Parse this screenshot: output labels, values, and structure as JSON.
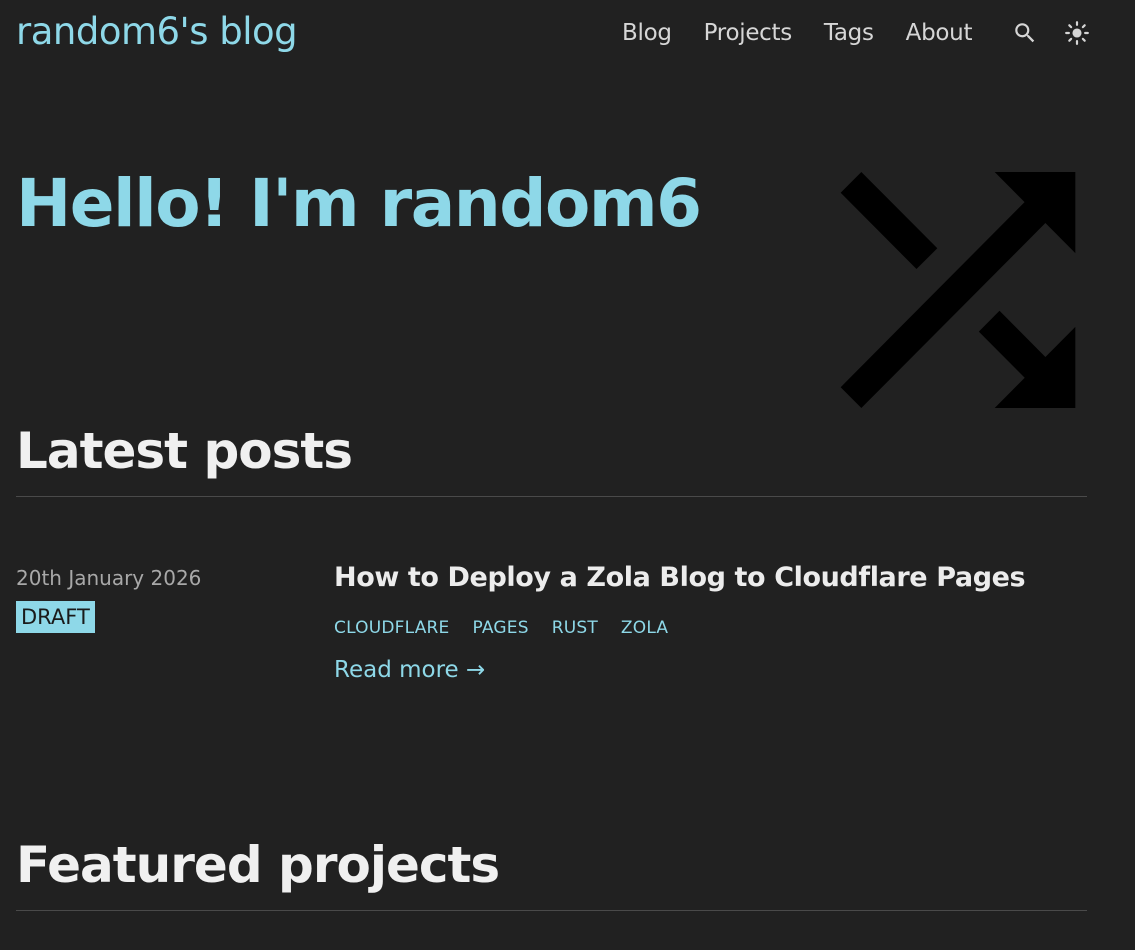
{
  "header": {
    "site_title": "random6's blog",
    "nav": [
      {
        "label": "Blog"
      },
      {
        "label": "Projects"
      },
      {
        "label": "Tags"
      },
      {
        "label": "About"
      }
    ],
    "icons": [
      "search-icon",
      "theme-toggle-sun-icon"
    ]
  },
  "hero": {
    "title": "Hello! I'm random6",
    "logo_icon": "shuffle-icon"
  },
  "latest_posts": {
    "heading": "Latest posts",
    "posts": [
      {
        "date": "20th January 2026",
        "badge": "DRAFT",
        "title": "How to Deploy a Zola Blog to Cloudflare Pages",
        "tags": [
          "CLOUDFLARE",
          "PAGES",
          "RUST",
          "ZOLA"
        ],
        "read_more": "Read more →"
      }
    ]
  },
  "featured_projects": {
    "heading": "Featured projects"
  },
  "colors": {
    "background": "#212121",
    "accent": "#8ed8e8",
    "text": "#e8e8e8",
    "muted": "#a8a8a8",
    "logo": "#000000"
  }
}
